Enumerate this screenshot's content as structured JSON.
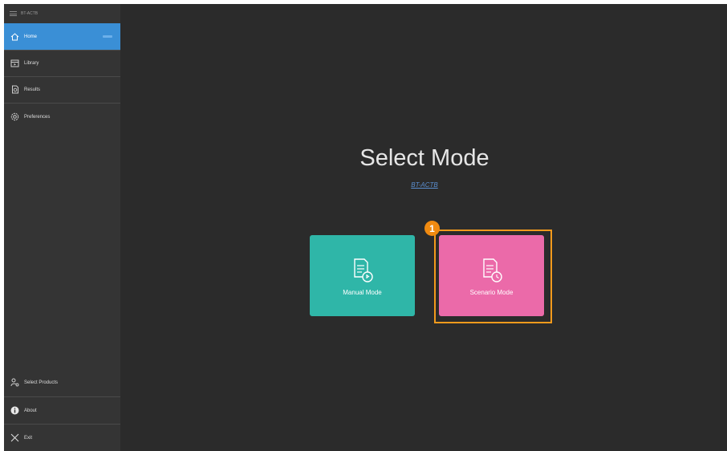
{
  "app": {
    "title": "BT-ACTB"
  },
  "sidebar": {
    "items": [
      {
        "label": "Home",
        "icon": "home-icon",
        "active": true
      },
      {
        "label": "Library",
        "icon": "library-icon",
        "active": false
      },
      {
        "label": "Results",
        "icon": "results-icon",
        "active": false
      },
      {
        "label": "Preferences",
        "icon": "gear-icon",
        "active": false
      }
    ],
    "bottom_items": [
      {
        "label": "Select Products",
        "icon": "user-gear-icon"
      },
      {
        "label": "About",
        "icon": "info-icon"
      },
      {
        "label": "Exit",
        "icon": "close-icon"
      }
    ]
  },
  "main": {
    "title": "Select Mode",
    "product": "BT-ACTB",
    "cards": [
      {
        "label": "Manual Mode",
        "icon": "manual-mode-icon",
        "color": "#2fb6a8"
      },
      {
        "label": "Scenario Mode",
        "icon": "scenario-mode-icon",
        "color": "#eb6aa9"
      }
    ],
    "callout": {
      "number": "1",
      "color": "#f29a1c"
    }
  },
  "colors": {
    "sidebar_active": "#3a8fd6",
    "background": "#2b2b2b",
    "sidebar": "#343434"
  }
}
